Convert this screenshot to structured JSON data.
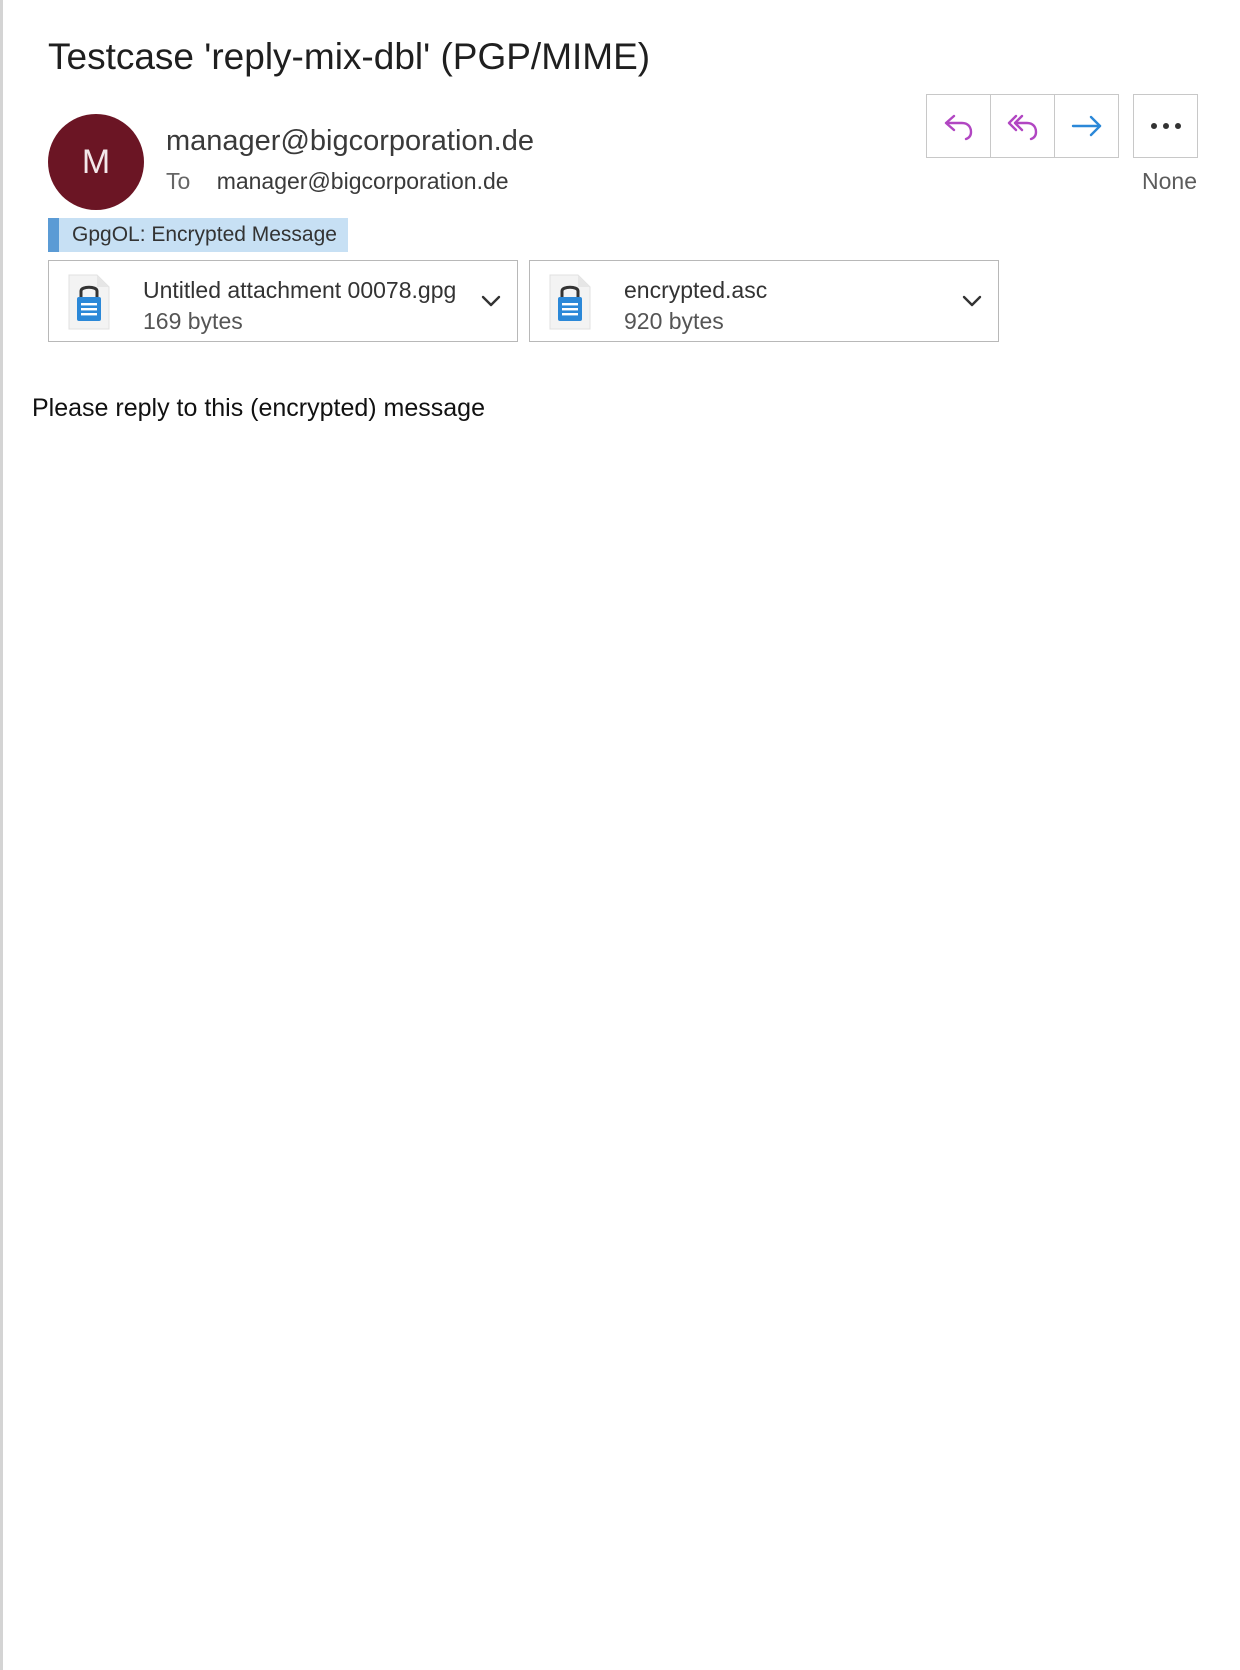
{
  "message": {
    "subject": "Testcase 'reply-mix-dbl' (PGP/MIME)",
    "avatar_initial": "M",
    "sender": "manager@bigcorporation.de",
    "to_label": "To",
    "to_address": "manager@bigcorporation.de",
    "category": "None",
    "crypto_banner": "GpgOL: Encrypted Message",
    "body": "Please reply to this (encrypted) message"
  },
  "actions": [
    {
      "icon": "reply-icon",
      "color": "#b146c2"
    },
    {
      "icon": "reply-all-icon",
      "color": "#b146c2"
    },
    {
      "icon": "forward-icon",
      "color": "#2b88d8"
    },
    {
      "icon": "more-options-icon",
      "color": "#333333"
    }
  ],
  "attachments": [
    {
      "name": "Untitled attachment 00078.gpg",
      "size": "169 bytes",
      "icon": "encrypted-file-icon"
    },
    {
      "name": "encrypted.asc",
      "size": "920 bytes",
      "icon": "encrypted-file-icon"
    }
  ],
  "colors": {
    "avatar": "#6b1524",
    "banner": "#c7e0f4",
    "banner_accent": "#5b9bd5"
  }
}
